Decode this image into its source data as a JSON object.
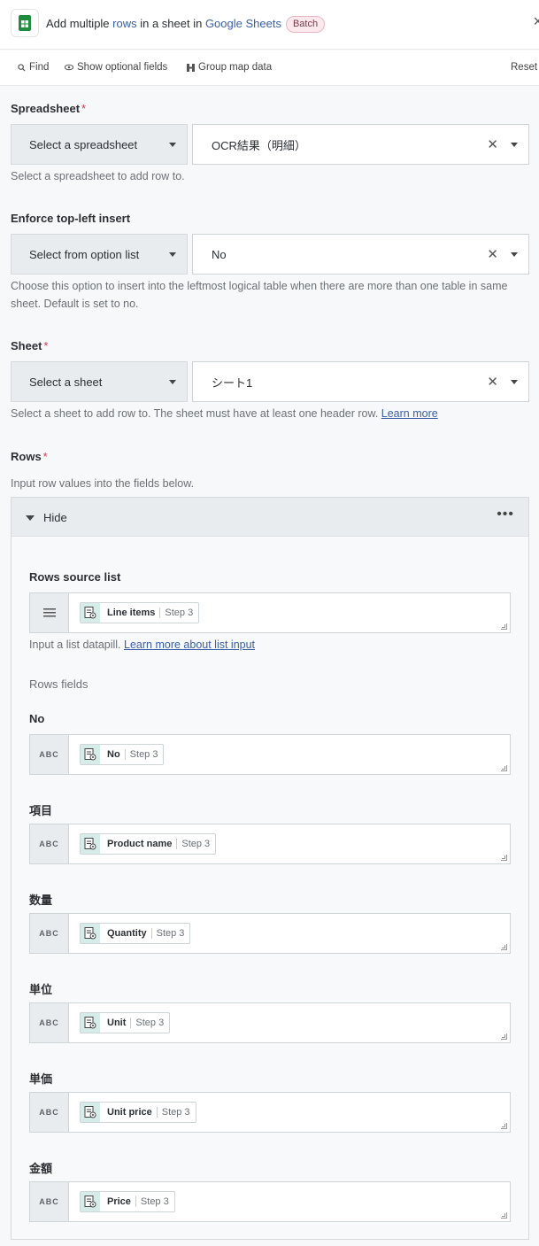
{
  "header": {
    "title_prefix": "Add multiple ",
    "title_link1": "rows",
    "title_mid": " in a sheet in ",
    "title_link2": "Google Sheets",
    "badge": "Batch",
    "close": "×"
  },
  "toolbar": {
    "find": "Find",
    "show_optional": "Show optional fields",
    "group_map": "Group map data",
    "reset": "Reset"
  },
  "spreadsheet": {
    "label": "Spreadsheet",
    "selector": "Select a spreadsheet",
    "value": "OCR結果（明細）",
    "help": "Select a spreadsheet to add row to."
  },
  "enforce": {
    "label": "Enforce top-left insert",
    "selector": "Select from option list",
    "value": "No",
    "help": "Choose this option to insert into the leftmost logical table when there are more than one table in same sheet. Default is set to no."
  },
  "sheet": {
    "label": "Sheet",
    "selector": "Select a sheet",
    "value": "シート1",
    "help": "Select a sheet to add row to. The sheet must have at least one header row. ",
    "help_link": "Learn more"
  },
  "rows": {
    "label": "Rows",
    "help": "Input row values into the fields below.",
    "panel_toggle": "Hide",
    "menu": "•••",
    "source_label": "Rows source list",
    "source_pill": {
      "name": "Line items",
      "step": "Step 3"
    },
    "source_help": "Input a list datapill. ",
    "source_help_link": "Learn more about list input",
    "fields_heading": "Rows fields",
    "abc": "ABC",
    "fields": [
      {
        "label": "No",
        "pill": "No",
        "step": "Step 3"
      },
      {
        "label": "項目",
        "pill": "Product name",
        "step": "Step 3"
      },
      {
        "label": "数量",
        "pill": "Quantity",
        "step": "Step 3"
      },
      {
        "label": "単位",
        "pill": "Unit",
        "step": "Step 3"
      },
      {
        "label": "単価",
        "pill": "Unit price",
        "step": "Step 3"
      },
      {
        "label": "金額",
        "pill": "Price",
        "step": "Step 3"
      }
    ]
  },
  "colors": {
    "accent_link": "#3a5fa8",
    "required": "#d1364c",
    "sheets_green": "#1e8e3e",
    "pill_icon_bg": "#d5ece9"
  }
}
